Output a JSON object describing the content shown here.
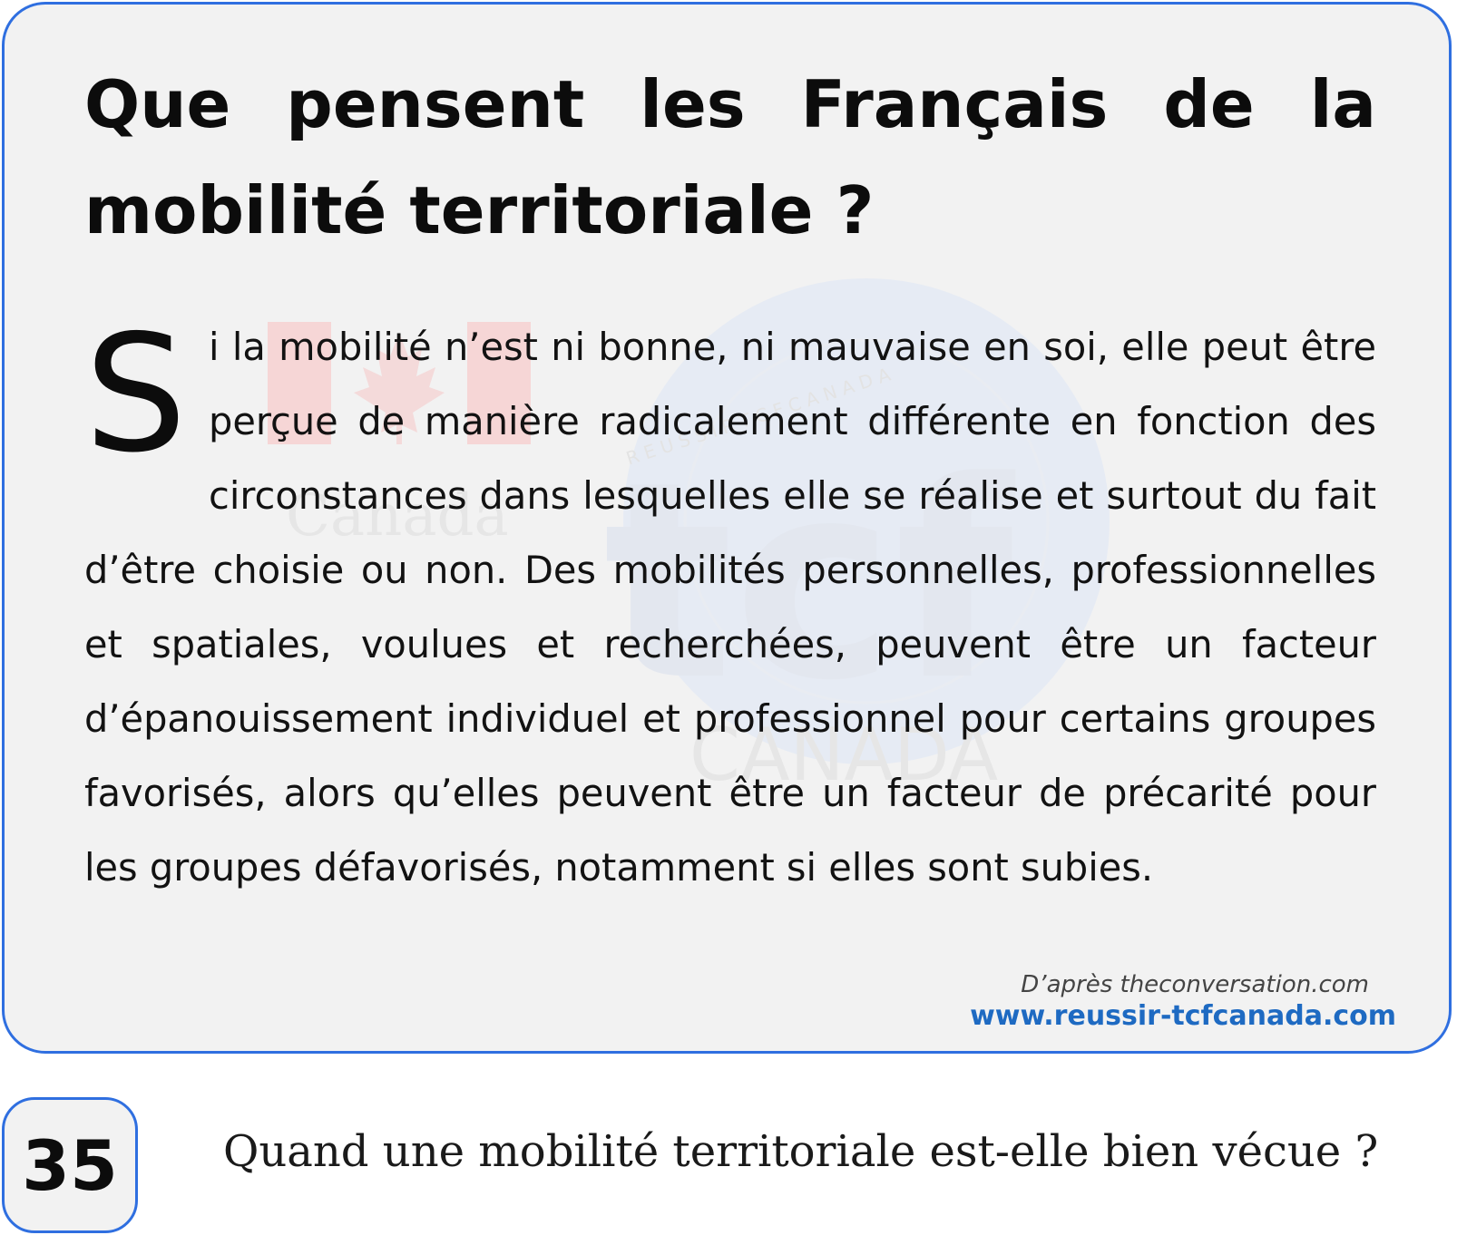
{
  "document": {
    "title_line1": "Que pensent les Français de la",
    "title_line2": "mobilité territoriale ?",
    "drop_cap": "S",
    "body_text": "i la mobilité n’est ni bonne, ni mauvaise en soi, elle peut être perçue de manière radicalement différente en fonction des circonstances dans lesquelles elle se réalise et surtout du fait d’être choisie ou non. Des mobilités personnelles, professionnelles et spatiales, voulues et recherchées, peuvent être un facteur d’épanouissement individuel et professionnel pour certains groupes favorisés, alors qu’elles peuvent être un facteur de précarité pour les groupes défavorisés, notamment si elles sont subies.",
    "source": "D’après theconversation.com",
    "website": "www.reussir-tcfcanada.com"
  },
  "watermark": {
    "canada_label": "Canada",
    "tcf_label": "tcf",
    "canada_caps": "CANADA",
    "ring_text": "R E U S S I R   T C F   C A N A D A"
  },
  "question": {
    "number": "35",
    "text": "Quand une mobilité territoriale est-elle bien vécue ?"
  },
  "colors": {
    "border": "#2f6fe0",
    "card_background": "#f2f2f2",
    "website_link": "#1e6ac2"
  }
}
